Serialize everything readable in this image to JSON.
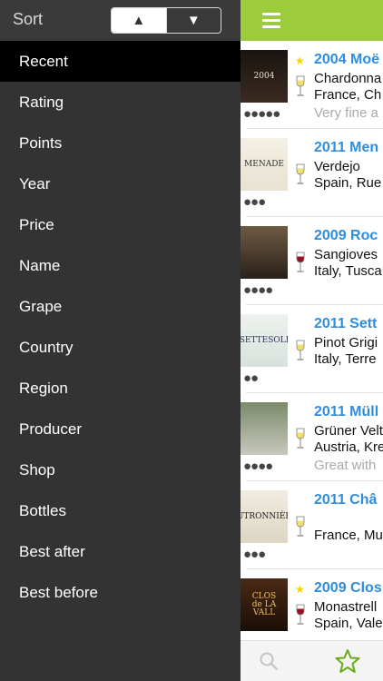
{
  "sidebar": {
    "sort_title": "Sort",
    "sort_up_glyph": "▲",
    "sort_down_glyph": "▼",
    "items": [
      {
        "label": "Recent",
        "selected": true
      },
      {
        "label": "Rating"
      },
      {
        "label": "Points"
      },
      {
        "label": "Year"
      },
      {
        "label": "Price"
      },
      {
        "label": "Name"
      },
      {
        "label": "Grape"
      },
      {
        "label": "Country"
      },
      {
        "label": "Region"
      },
      {
        "label": "Producer"
      },
      {
        "label": "Shop"
      },
      {
        "label": "Bottles"
      },
      {
        "label": "Best after"
      },
      {
        "label": "Best before"
      }
    ]
  },
  "topbar": {
    "menu_icon": "hamburger-icon",
    "color": "#9ccc3c"
  },
  "wines": [
    {
      "title": "2004 Moë",
      "line1": "Chardonna",
      "line2": "France, Ch",
      "line3": "Very fine a",
      "dots": "●●●●●",
      "glass": "white",
      "starred": true,
      "label_text": "2004"
    },
    {
      "title": "2011 Men",
      "line1": "Verdejo",
      "line2": "Spain, Rue",
      "line3": "",
      "dots": "●●●",
      "glass": "white",
      "starred": false,
      "label_text": "MENADE"
    },
    {
      "title": "2009 Roc",
      "line1": "Sangioves",
      "line2": "Italy, Tusca",
      "line3": "",
      "dots": "●●●●",
      "glass": "red",
      "starred": false,
      "label_text": ""
    },
    {
      "title": "2011 Sett",
      "line1": "Pinot Grigi",
      "line2": "Italy, Terre",
      "line3": "",
      "dots": "●●",
      "glass": "white",
      "starred": false,
      "label_text": "SETTESOLI"
    },
    {
      "title": "2011 Müll",
      "line1": "Grüner Velt",
      "line2": "Austria, Kre",
      "line3": "Great with",
      "dots": "●●●●",
      "glass": "white",
      "starred": false,
      "label_text": ""
    },
    {
      "title": "2011 Châ",
      "line1": "",
      "line2": "France, Mu",
      "line3": "",
      "dots": "●●●",
      "glass": "white",
      "starred": false,
      "label_text": "SAUTRONNIÈRES"
    },
    {
      "title": "2009 Clos",
      "line1": "Monastrell",
      "line2": "Spain, Vale",
      "line3": "",
      "dots": "",
      "glass": "red",
      "starred": true,
      "label_text": "CLOS de LA VALL"
    }
  ],
  "tabbar": {
    "search_icon": "search-icon",
    "favorites_icon": "star-icon",
    "accent": "#6aaa1c"
  }
}
